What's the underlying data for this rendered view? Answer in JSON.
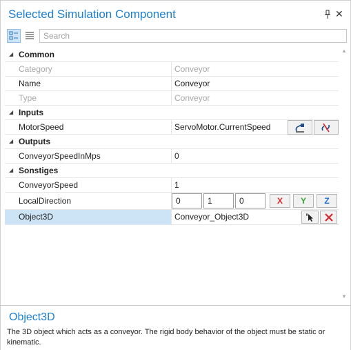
{
  "panel": {
    "title": "Selected Simulation Component"
  },
  "toolbar": {
    "search_placeholder": "Search"
  },
  "categories": {
    "common": "Common",
    "inputs": "Inputs",
    "outputs": "Outputs",
    "sonstiges": "Sonstiges"
  },
  "properties": {
    "category": {
      "name": "Category",
      "value": "Conveyor"
    },
    "name": {
      "name": "Name",
      "value": "Conveyor"
    },
    "type": {
      "name": "Type",
      "value": "Conveyor"
    },
    "motor_speed": {
      "name": "MotorSpeed",
      "value": "ServoMotor.CurrentSpeed"
    },
    "conveyor_speed_mps": {
      "name": "ConveyorSpeedInMps",
      "value": "0"
    },
    "conveyor_speed": {
      "name": "ConveyorSpeed",
      "value": "1"
    },
    "local_direction": {
      "name": "LocalDirection",
      "x": "0",
      "y": "1",
      "z": "0",
      "x_btn": "X",
      "y_btn": "Y",
      "z_btn": "Z"
    },
    "object3d": {
      "name": "Object3D",
      "value": "Conveyor_Object3D"
    }
  },
  "help": {
    "title": "Object3D",
    "text": "The 3D object which acts as a conveyor. The rigid body behavior of the object must be static or kinematic."
  },
  "colors": {
    "accent": "#1b7fd1",
    "selection": "#cde4f7",
    "x_axis": "#d9262b",
    "y_axis": "#3aa53a",
    "z_axis": "#1f6fd1"
  },
  "icons": [
    "pin-icon",
    "close-icon",
    "categorized-view-icon",
    "alphabetical-view-icon",
    "connect-icon",
    "disconnect-icon",
    "pick-object-icon",
    "clear-icon",
    "expand-triangle-icon"
  ]
}
